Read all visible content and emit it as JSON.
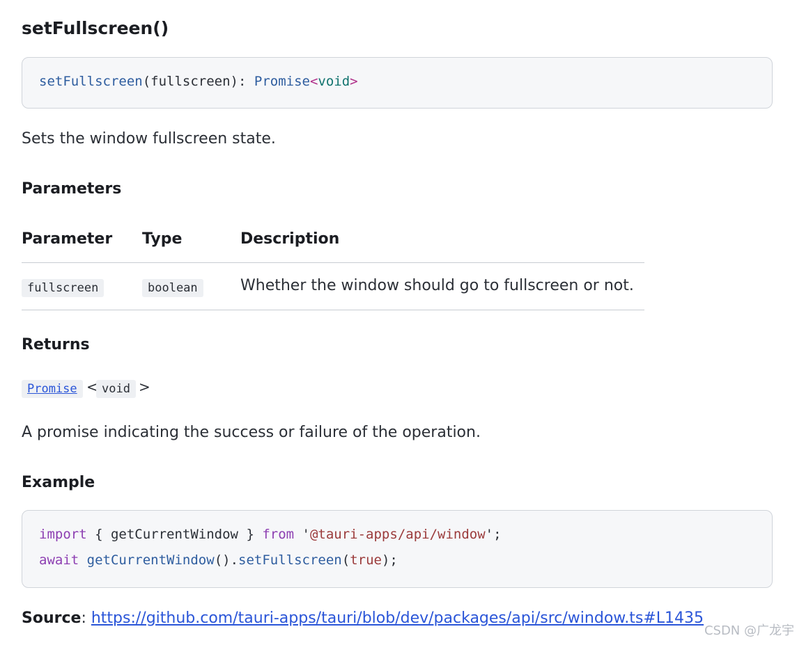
{
  "method": {
    "title": "setFullscreen()",
    "signature": {
      "name": "setFullscreen",
      "params": "(fullscreen): ",
      "return_type": "Promise",
      "lt": "<",
      "generic": "void",
      "gt": ">"
    },
    "description": "Sets the window fullscreen state."
  },
  "parameters": {
    "heading": "Parameters",
    "columns": [
      "Parameter",
      "Type",
      "Description"
    ],
    "rows": [
      {
        "name": "fullscreen",
        "type": "boolean",
        "description": "Whether the window should go to fullscreen or not."
      }
    ]
  },
  "returns": {
    "heading": "Returns",
    "type_link": "Promise",
    "lt": "<",
    "generic": "void",
    "gt": ">",
    "description": "A promise indicating the success or failure of the operation."
  },
  "example": {
    "heading": "Example",
    "line1": {
      "kw_import": "import",
      "braces_open": " { ",
      "ident": "getCurrentWindow",
      "braces_close": " } ",
      "kw_from": "from",
      "quote_open": " '",
      "module": "@tauri-apps/api/window",
      "quote_close": "';"
    },
    "line2": {
      "kw_await": "await",
      "fn": "getCurrentWindow",
      "call": "().",
      "method": "setFullscreen",
      "paren_open": "(",
      "arg": "true",
      "paren_close": ");"
    }
  },
  "source": {
    "label": "Source",
    "colon": ": ",
    "url": "https://github.com/tauri-apps/tauri/blob/dev/packages/api/src/window.ts#L1435"
  },
  "watermark": "CSDN @广龙宇"
}
